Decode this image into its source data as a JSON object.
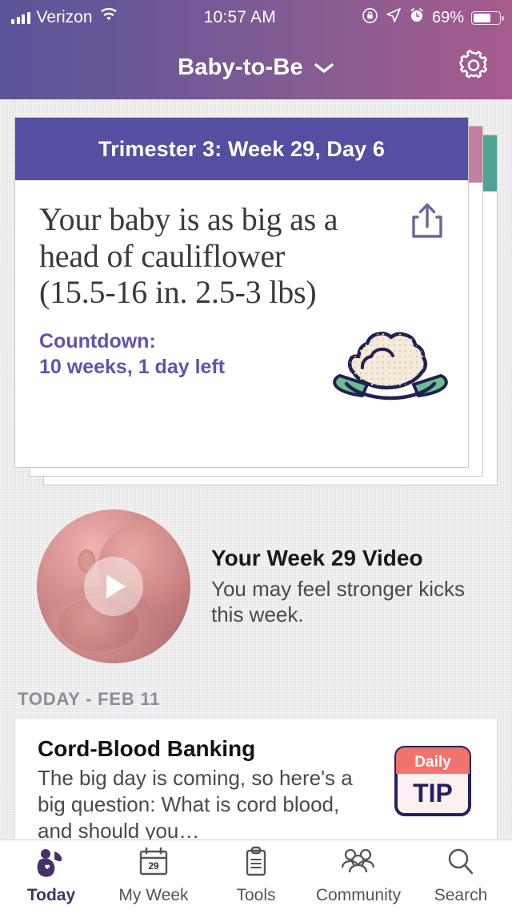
{
  "status_bar": {
    "carrier": "Verizon",
    "time": "10:57 AM",
    "battery_percent": "69%",
    "icons": [
      "signal-bars-icon",
      "wifi-icon",
      "rotation-lock-icon",
      "location-arrow-icon",
      "alarm-clock-icon",
      "battery-icon"
    ]
  },
  "nav": {
    "title": "Baby-to-Be",
    "chevron": "chevron-down-icon",
    "settings": "gear-icon"
  },
  "card": {
    "header": "Trimester 3: Week 29, Day 6",
    "size_text": "Your baby is as big as a head of cauliflower",
    "measurements": "(15.5-16 in. 2.5-3 lbs)",
    "countdown_label": "Countdown:",
    "countdown_value": "10 weeks, 1 day left",
    "share": "share-icon",
    "fruit_icon": "cauliflower-icon",
    "header_color": "#544fa0",
    "behind_card_1_color": "#c0809f",
    "behind_card_2_color": "#4fa395",
    "countdown_color": "#5b56ad"
  },
  "video": {
    "title": "Your Week 29 Video",
    "subtitle": "You may feel stronger kicks this week.",
    "play": "play-button-icon"
  },
  "today": {
    "section_label": "TODAY - FEB 11",
    "tip": {
      "title": "Cord-Blood Banking",
      "body": "The big day is coming, so here's a big question: What is cord blood, and should you…",
      "badge_top": "Daily",
      "badge_bottom": "TIP",
      "badge_band_color": "#f0736e",
      "badge_text_color": "#252060"
    }
  },
  "tabbar": {
    "active_color": "#463168",
    "items": [
      {
        "label": "Today",
        "icon": "pregnant-silhouette-icon",
        "active": true
      },
      {
        "label": "My Week",
        "icon": "calendar-icon",
        "calendar_day": "29",
        "active": false
      },
      {
        "label": "Tools",
        "icon": "clipboard-icon",
        "active": false
      },
      {
        "label": "Community",
        "icon": "people-group-icon",
        "active": false
      },
      {
        "label": "Search",
        "icon": "search-icon",
        "active": false
      }
    ]
  }
}
